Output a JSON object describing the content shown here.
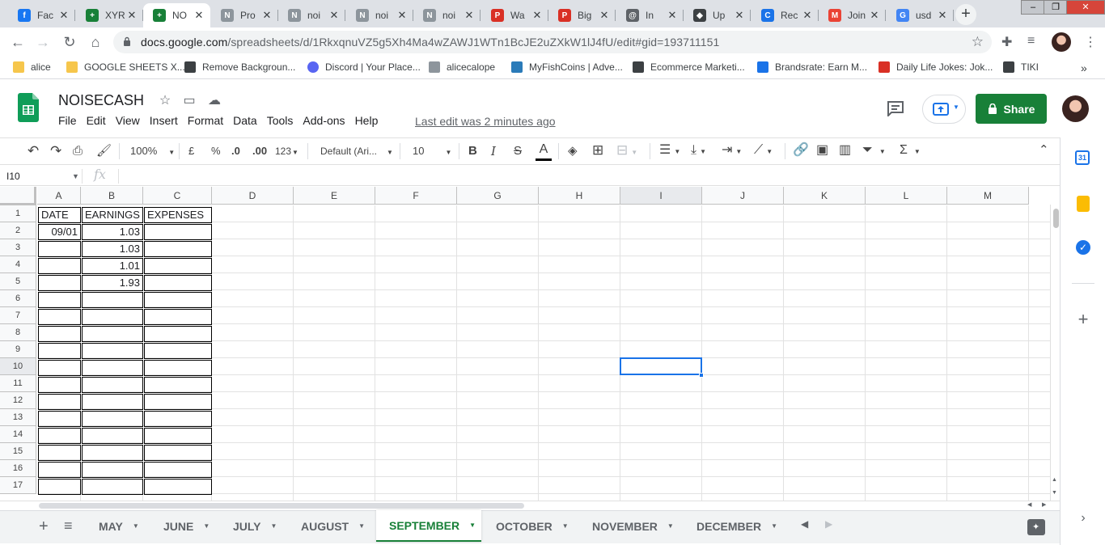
{
  "browser": {
    "tabs": [
      {
        "title": "Fac",
        "icon": "facebook-icon",
        "color": "#1877f2",
        "letter": "f"
      },
      {
        "title": "XYR",
        "icon": "sheets-icon",
        "color": "#188038",
        "letter": "+"
      },
      {
        "title": "NO",
        "icon": "sheets-icon",
        "color": "#188038",
        "letter": "+"
      },
      {
        "title": "Pro",
        "icon": "noisecash-icon",
        "color": "#8d959c",
        "letter": "N"
      },
      {
        "title": "noi",
        "icon": "noisecash-icon",
        "color": "#8d959c",
        "letter": "N"
      },
      {
        "title": "noi",
        "icon": "noisecash-icon",
        "color": "#8d959c",
        "letter": "N"
      },
      {
        "title": "noi",
        "icon": "noisecash-icon",
        "color": "#8d959c",
        "letter": "N"
      },
      {
        "title": "Wa",
        "icon": "pdf-icon",
        "color": "#d93025",
        "letter": "P"
      },
      {
        "title": "Big",
        "icon": "pdf-icon",
        "color": "#d93025",
        "letter": "P"
      },
      {
        "title": "In",
        "icon": "avatar-icon",
        "color": "#5f6368",
        "letter": "@"
      },
      {
        "title": "Up",
        "icon": "layers-icon",
        "color": "#3c4043",
        "letter": "◆"
      },
      {
        "title": "Rec",
        "icon": "record-icon",
        "color": "#1a73e8",
        "letter": "C"
      },
      {
        "title": "Join",
        "icon": "gmail-icon",
        "color": "#ea4335",
        "letter": "M"
      },
      {
        "title": "usd",
        "icon": "google-icon",
        "color": "#4285f4",
        "letter": "G"
      }
    ],
    "url_host": "docs.google.com",
    "url_path": "/spreadsheets/d/1RkxqnuVZ5g5Xh4Ma4wZAWJ1WTn1BcJE2uZXkW1lJ4fU/edit#gid=193711151",
    "bookmarks": [
      {
        "label": "alice",
        "icon": "folder-icon"
      },
      {
        "label": "GOOGLE SHEETS X...",
        "icon": "folder-icon"
      },
      {
        "label": "Remove Backgroun...",
        "icon": "layers-icon"
      },
      {
        "label": "Discord | Your Place...",
        "icon": "discord-icon"
      },
      {
        "label": "alicecalope",
        "icon": "noisecash-icon"
      },
      {
        "label": "MyFishCoins | Adve...",
        "icon": "fish-icon"
      },
      {
        "label": "Ecommerce Marketi...",
        "icon": "leaf-icon"
      },
      {
        "label": "Brandsrate: Earn M...",
        "icon": "star-icon"
      },
      {
        "label": "Daily Life Jokes: Jok...",
        "icon": "rd-icon"
      },
      {
        "label": "TIKI",
        "icon": "tiki-icon"
      }
    ],
    "bookmarks_more": "»"
  },
  "sheets": {
    "title": "NOISECASH",
    "menu": [
      "File",
      "Edit",
      "View",
      "Insert",
      "Format",
      "Data",
      "Tools",
      "Add-ons",
      "Help"
    ],
    "last_edit": "Last edit was 2 minutes ago",
    "share_label": "Share",
    "toolbar": {
      "zoom": "100%",
      "currency": "£",
      "percent": "%",
      "dec_decrease": ".0",
      "dec_increase": ".00",
      "number_format": "123",
      "font": "Default (Ari...",
      "font_size": "10",
      "bold": "B",
      "italic": "I",
      "strike": "S",
      "text_color": "A"
    },
    "name_box": "I10",
    "fx": "fx",
    "columns": [
      "A",
      "B",
      "C",
      "D",
      "E",
      "F",
      "G",
      "H",
      "I",
      "J",
      "K",
      "L",
      "M"
    ],
    "rows": [
      "1",
      "2",
      "3",
      "4",
      "5",
      "6",
      "7",
      "8",
      "9",
      "10",
      "11",
      "12",
      "13",
      "14",
      "15",
      "16",
      "17"
    ],
    "header_row": [
      "DATE",
      "EARNINGS",
      "EXPENSES"
    ],
    "data_rows": [
      [
        "09/01",
        "1.03",
        ""
      ],
      [
        "",
        "1.03",
        ""
      ],
      [
        "",
        "1.01",
        ""
      ],
      [
        "",
        "1.93",
        ""
      ]
    ],
    "selected_cell": "I10",
    "sheet_tabs": [
      "MAY",
      "JUNE",
      "JULY",
      "AUGUST",
      "SEPTEMBER",
      "OCTOBER",
      "NOVEMBER",
      "DECEMBER"
    ],
    "active_tab": "SEPTEMBER"
  }
}
